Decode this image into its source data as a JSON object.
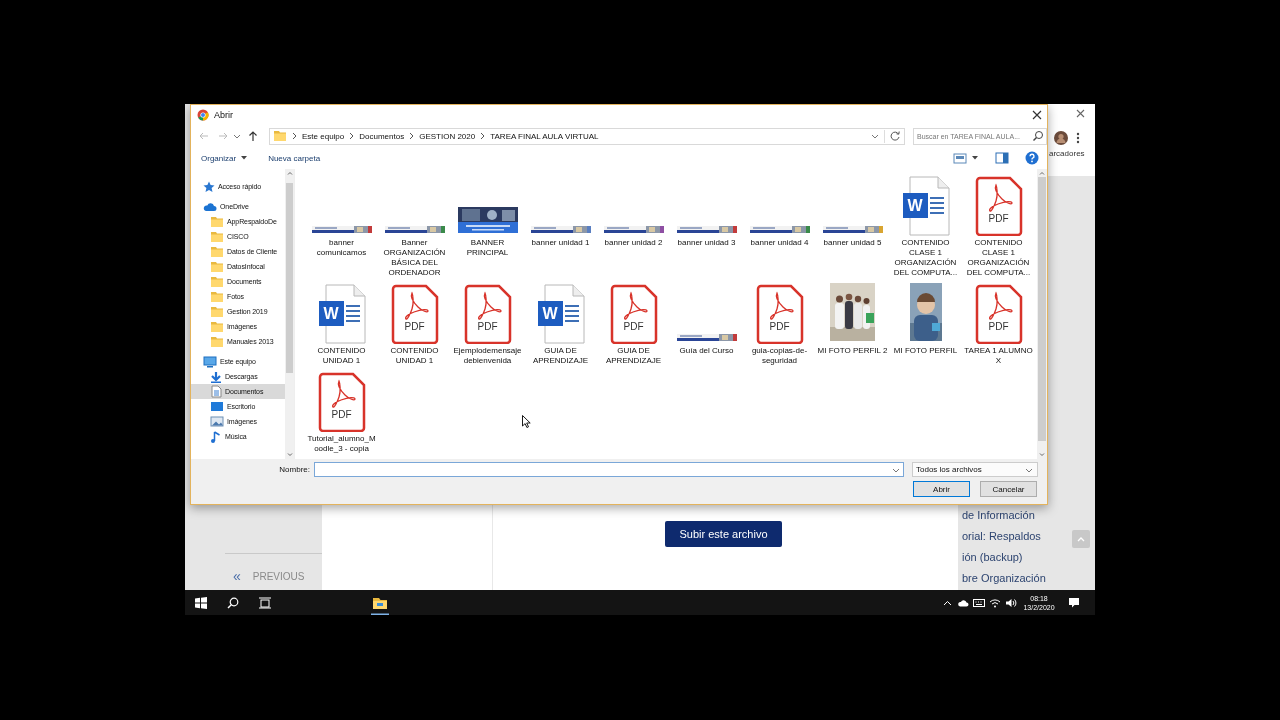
{
  "browser": {
    "bookmarks_label": "arcadores",
    "page": {
      "previous_arrow": "«",
      "previous_label": "PREVIOUS",
      "upload_button": "Subir este archivo",
      "sidebar_links": [
        "de Información",
        "orial: Respaldos",
        "ión (backup)",
        "bre Organización"
      ]
    }
  },
  "dialog": {
    "title": "Abrir",
    "breadcrumb": [
      "Este equipo",
      "Documentos",
      "GESTION 2020",
      "TAREA FINAL AULA VIRTUAL"
    ],
    "search": {
      "placeholder": "Buscar en TAREA FINAL AULA..."
    },
    "toolbar": [
      "Organizar",
      "Nueva carpeta"
    ],
    "sidebar": [
      {
        "label": "Acceso rápido",
        "kind": "star",
        "selected": false
      },
      {
        "label": "OneDrive",
        "kind": "cloud",
        "selected": false,
        "children": [
          {
            "label": "AppRespaldoDe",
            "kind": "folder",
            "selected": false
          },
          {
            "label": "CISCO",
            "kind": "folder",
            "selected": false
          },
          {
            "label": "Datos de Cliente",
            "kind": "folder",
            "selected": false
          },
          {
            "label": "DatosInfocal",
            "kind": "folder",
            "selected": false
          },
          {
            "label": "Documents",
            "kind": "folder",
            "selected": false
          },
          {
            "label": "Fotos",
            "kind": "folder",
            "selected": false
          },
          {
            "label": "Gestion 2019",
            "kind": "folder",
            "selected": false
          },
          {
            "label": "Imágenes",
            "kind": "folder",
            "selected": false
          },
          {
            "label": "Manuales 2013",
            "kind": "folder",
            "selected": false
          }
        ]
      },
      {
        "label": "Este equipo",
        "kind": "computer",
        "selected": false,
        "children": [
          {
            "label": "Descargas",
            "kind": "download",
            "selected": false
          },
          {
            "label": "Documentos",
            "kind": "documents",
            "selected": true
          },
          {
            "label": "Escritorio",
            "kind": "desktop",
            "selected": false
          },
          {
            "label": "Imágenes",
            "kind": "pictures",
            "selected": false
          },
          {
            "label": "Música",
            "kind": "music",
            "selected": false
          }
        ]
      }
    ],
    "files": [
      {
        "name": "banner comunicamos",
        "kind": "banner"
      },
      {
        "name": "Banner ORGANIZACIÓN BÁSICA DEL ORDENADOR",
        "kind": "banner"
      },
      {
        "name": "BANNER PRINCIPAL",
        "kind": "banner-large"
      },
      {
        "name": "banner unidad 1",
        "kind": "banner"
      },
      {
        "name": "banner unidad 2",
        "kind": "banner"
      },
      {
        "name": "banner unidad 3",
        "kind": "banner"
      },
      {
        "name": "banner unidad 4",
        "kind": "banner"
      },
      {
        "name": "banner unidad 5",
        "kind": "banner"
      },
      {
        "name": "CONTENIDO CLASE 1 ORGANIZACIÓN DEL COMPUTA...",
        "kind": "word",
        "badge": "W"
      },
      {
        "name": "CONTENIDO CLASE 1 ORGANIZACIÓN DEL COMPUTA...",
        "kind": "pdf",
        "badge": "PDF"
      },
      {
        "name": "CONTENIDO UNIDAD 1",
        "kind": "word",
        "badge": "W"
      },
      {
        "name": "CONTENIDO UNIDAD 1",
        "kind": "pdf",
        "badge": "PDF"
      },
      {
        "name": "Ejemplodemensajedebienvenida",
        "kind": "pdf",
        "badge": "PDF"
      },
      {
        "name": "GUIA DE APRENDIZAJE",
        "kind": "word",
        "badge": "W"
      },
      {
        "name": "GUIA DE APRENDIZAJE",
        "kind": "pdf",
        "badge": "PDF"
      },
      {
        "name": "Guía del Curso",
        "kind": "banner"
      },
      {
        "name": "guia-copias-de-seguridad",
        "kind": "pdf",
        "badge": "PDF"
      },
      {
        "name": "MI FOTO PERFIL 2"
      },
      {
        "name": "MI FOTO PERFIL",
        "kind": "portrait"
      },
      {
        "name": "TAREA 1 ALUMNO X",
        "kind": "pdf",
        "badge": "PDF"
      },
      {
        "name": "Tutorial_alumno_Moodle_3 - copia",
        "kind": "pdf",
        "badge": "PDF"
      }
    ],
    "filename_label": "Nombre:",
    "file_type": "Todos los archivos",
    "buttons": [
      "Abrir",
      "Cancelar"
    ]
  },
  "taskbar": {
    "time": "08:18",
    "date": "13/2/2020"
  }
}
